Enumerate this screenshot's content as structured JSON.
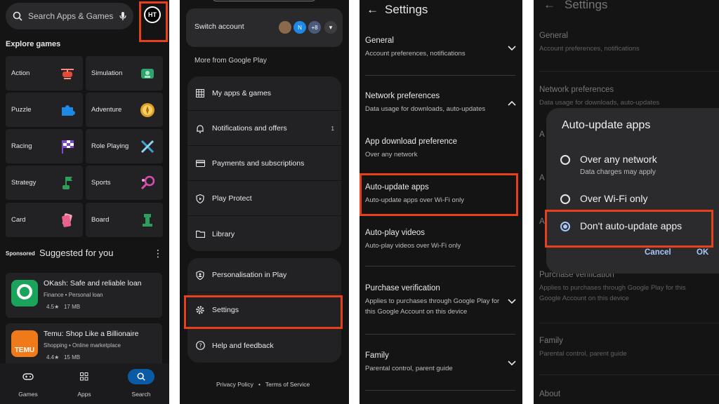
{
  "colors": {
    "highlight": "#e8401c",
    "background": "#141414",
    "card": "#222225",
    "accent": "#a8c7fa",
    "nav_active": "#0b5aa6"
  },
  "panel1": {
    "search_placeholder": "Search Apps & Games",
    "avatar_text": "HT",
    "explore_title": "Explore games",
    "categories": [
      {
        "label": "Action",
        "icon": "helicopter-icon",
        "color": "#e04b3a"
      },
      {
        "label": "Simulation",
        "icon": "simulation-icon",
        "color": "#2fa36b"
      },
      {
        "label": "Puzzle",
        "icon": "puzzle-icon",
        "color": "#1e88e5"
      },
      {
        "label": "Adventure",
        "icon": "compass-icon",
        "color": "#e0a020"
      },
      {
        "label": "Racing",
        "icon": "flag-icon",
        "color": "#7b4cc6"
      },
      {
        "label": "Role Playing",
        "icon": "swords-icon",
        "color": "#3aa3d6"
      },
      {
        "label": "Strategy",
        "icon": "strategy-icon",
        "color": "#2e9e5b"
      },
      {
        "label": "Sports",
        "icon": "racket-icon",
        "color": "#d84fb0"
      },
      {
        "label": "Card",
        "icon": "cards-icon",
        "color": "#e8628a"
      },
      {
        "label": "Board",
        "icon": "chess-icon",
        "color": "#2e9e5b"
      }
    ],
    "sponsored_label": "Sponsored",
    "suggested_title": "Suggested for you",
    "apps": [
      {
        "name": "OKash: Safe and reliable loan",
        "meta": "Finance • Personal loan",
        "rating": "4.5★",
        "size": "17 MB",
        "icon_color": "#1aa35a"
      },
      {
        "name": "Temu: Shop Like a Billionaire",
        "meta": "Shopping • Online marketplace",
        "rating": "4.4★",
        "size": "15 MB",
        "icon_color": "#f07a1a",
        "icon_text": "TEMU"
      }
    ],
    "nav": [
      {
        "label": "Games",
        "icon": "gamepad-icon"
      },
      {
        "label": "Apps",
        "icon": "apps-grid-icon"
      },
      {
        "label": "Search",
        "icon": "search-icon"
      }
    ]
  },
  "panel2": {
    "switch_account": "Switch account",
    "avatar_initial": "N",
    "more_accounts": "+8",
    "more_from": "More from Google Play",
    "group1": [
      {
        "label": "My apps & games",
        "icon": "grid-icon",
        "badge": ""
      },
      {
        "label": "Notifications and offers",
        "icon": "bell-icon",
        "badge": "1"
      },
      {
        "label": "Payments and subscriptions",
        "icon": "card-icon",
        "badge": ""
      },
      {
        "label": "Play Protect",
        "icon": "shield-play-icon",
        "badge": ""
      },
      {
        "label": "Library",
        "icon": "folder-icon",
        "badge": ""
      }
    ],
    "group2": [
      {
        "label": "Personalisation in Play",
        "icon": "shield-person-icon"
      },
      {
        "label": "Settings",
        "icon": "gear-icon"
      },
      {
        "label": "Help and feedback",
        "icon": "help-icon"
      }
    ],
    "footer": {
      "privacy": "Privacy Policy",
      "sep": "•",
      "terms": "Terms of Service"
    }
  },
  "panel3": {
    "title": "Settings",
    "items": [
      {
        "title": "General",
        "subtitle": "Account preferences, notifications",
        "chevron": "down"
      },
      {
        "title": "Network preferences",
        "subtitle": "Data usage for downloads, auto-updates",
        "chevron": "up"
      },
      {
        "title": "App download preference",
        "subtitle": "Over any network"
      },
      {
        "title": "Auto-update apps",
        "subtitle": "Auto-update apps over Wi-Fi only"
      },
      {
        "title": "Auto-play videos",
        "subtitle": "Auto-play videos over Wi-Fi only"
      },
      {
        "title": "Purchase verification",
        "subtitle": "Applies to purchases through Google Play for this Google Account on this device",
        "chevron": "down"
      },
      {
        "title": "Family",
        "subtitle": "Parental control, parent guide",
        "chevron": "down"
      }
    ]
  },
  "panel4": {
    "title": "Settings",
    "bg_items": [
      {
        "title": "General",
        "subtitle": "Account preferences, notifications"
      },
      {
        "title": "Network preferences",
        "subtitle": "Data usage for downloads, auto-updates"
      },
      {
        "title": "Purchase verification",
        "subtitle": "Applies to purchases through Google Play for this Google Account on this device"
      },
      {
        "title": "Family",
        "subtitle": "Parental control, parent guide"
      },
      {
        "title": "About",
        "subtitle": ""
      }
    ],
    "dialog": {
      "title": "Auto-update apps",
      "options": [
        {
          "label": "Over any network",
          "sub": "Data charges may apply",
          "selected": false
        },
        {
          "label": "Over Wi-Fi only",
          "sub": "",
          "selected": false
        },
        {
          "label": "Don't auto-update apps",
          "sub": "",
          "selected": true
        }
      ],
      "cancel": "Cancel",
      "ok": "OK"
    }
  }
}
